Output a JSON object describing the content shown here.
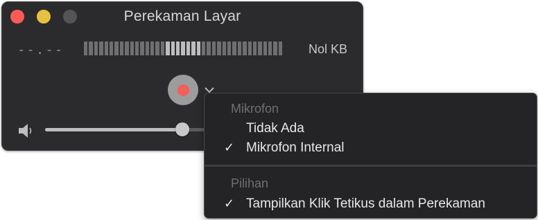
{
  "window": {
    "title": "Perekaman Layar",
    "time": "--.--",
    "file_size": "Nol KB",
    "level_meter": {
      "total_bars": 39,
      "active_from": 16,
      "active_to": 22
    },
    "volume": 0.45,
    "record_button_icon": "record-icon",
    "options_icon": "chevron-down-icon",
    "speaker_icon": "speaker-icon",
    "colors": {
      "close": "#fc5b57",
      "minimize": "#e6c140",
      "record": "#f2605b"
    }
  },
  "menu": {
    "sections": [
      {
        "header": "Mikrofon",
        "items": [
          {
            "label": "Tidak Ada",
            "checked": false
          },
          {
            "label": "Mikrofon Internal",
            "checked": true
          }
        ]
      },
      {
        "header": "Pilihan",
        "items": [
          {
            "label": "Tampilkan Klik Tetikus dalam Perekaman",
            "checked": true
          }
        ]
      }
    ],
    "check_mark": "✓"
  }
}
